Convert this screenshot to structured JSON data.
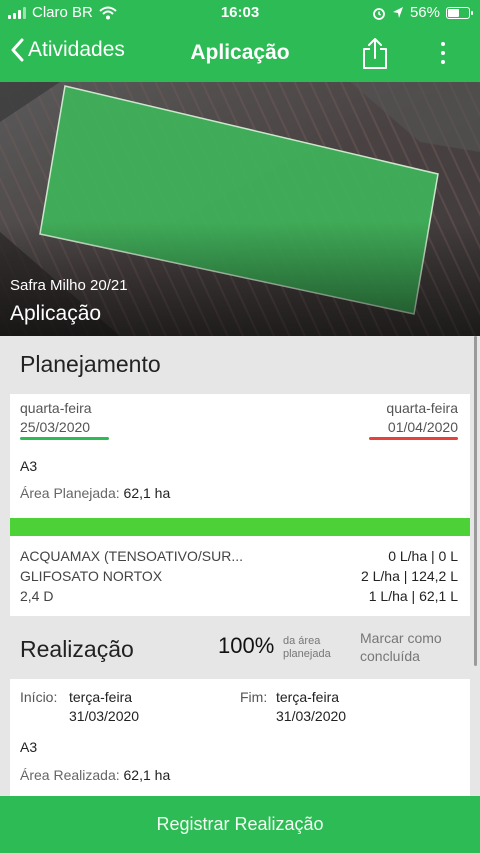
{
  "status_bar": {
    "carrier": "Claro BR",
    "time": "16:03",
    "battery": "56%",
    "battery_level": 0.56
  },
  "nav": {
    "back_label": "Atividades",
    "title": "Aplicação",
    "share_icon": "share-icon",
    "more_icon": "more-vertical-icon"
  },
  "hero": {
    "season": "Safra Milho 20/21",
    "title": "Aplicação"
  },
  "planning": {
    "title": "Planejamento",
    "start_weekday": "quarta-feira",
    "start_date": "25/03/2020",
    "end_weekday": "quarta-feira",
    "end_date": "01/04/2020",
    "field": "A3",
    "area_label": "Área Planejada:",
    "area_value": "62,1 ha",
    "progress": 1.0,
    "products": [
      {
        "name": "ACQUAMAX (TENSOATIVO/SUR...",
        "rate": "0 L/ha | 0 L"
      },
      {
        "name": "GLIFOSATO NORTOX",
        "rate": "2 L/ha | 124,2 L"
      },
      {
        "name": "2,4 D",
        "rate": "1 L/ha | 62,1 L"
      }
    ]
  },
  "realization": {
    "title": "Realização",
    "percent": "100%",
    "percent_note_line1": "da área",
    "percent_note_line2": "planejada",
    "mark_done_line1": "Marcar como",
    "mark_done_line2": "concluída",
    "start_label": "Início:",
    "start_weekday": "terça-feira",
    "start_date": "31/03/2020",
    "end_label": "Fim:",
    "end_weekday": "terça-feira",
    "end_date": "31/03/2020",
    "field": "A3",
    "area_label": "Área Realizada:",
    "area_value": "62,1 ha"
  },
  "footer": {
    "button_label": "Registrar Realização"
  },
  "colors": {
    "brand_green": "#2dbb55",
    "progress_green": "#4cd137",
    "end_date_red": "#e8413a"
  }
}
